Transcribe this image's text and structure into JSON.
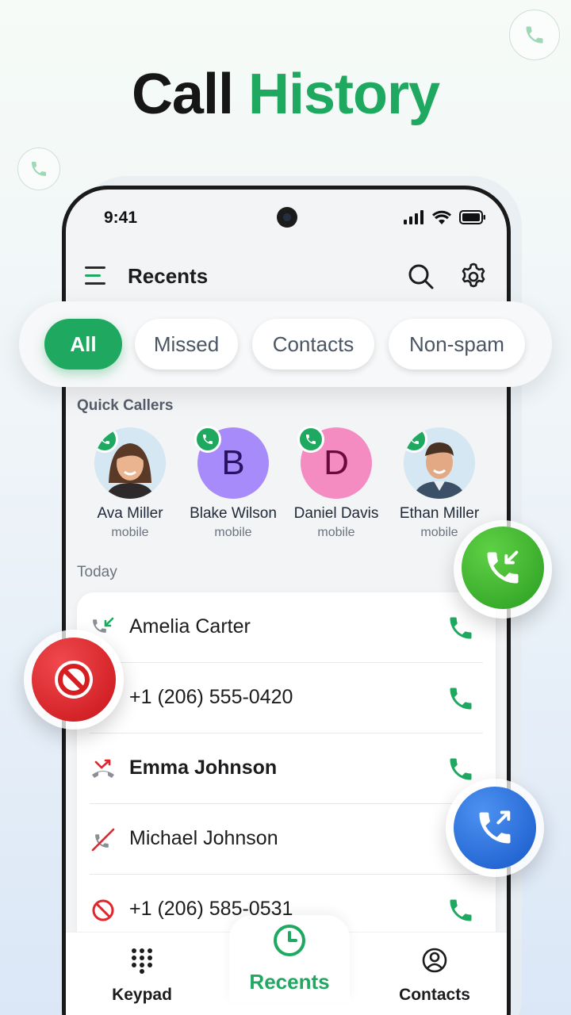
{
  "headline": {
    "part1": "Call",
    "part2": "History"
  },
  "status_bar": {
    "time": "9:41"
  },
  "appbar": {
    "title": "Recents"
  },
  "filters": [
    {
      "label": "All",
      "active": true
    },
    {
      "label": "Missed",
      "active": false
    },
    {
      "label": "Contacts",
      "active": false
    },
    {
      "label": "Non-spam",
      "active": false
    }
  ],
  "quick_callers": {
    "title": "Quick Callers",
    "items": [
      {
        "name": "Ava Miller",
        "type": "mobile",
        "initial": "",
        "avatar": "photo-woman"
      },
      {
        "name": "Blake Wilson",
        "type": "mobile",
        "initial": "B",
        "bg": "#a78bfa",
        "fg": "#2a1363"
      },
      {
        "name": "Daniel Davis",
        "type": "mobile",
        "initial": "D",
        "bg": "#f58cc1",
        "fg": "#6a0b3c"
      },
      {
        "name": "Ethan Miller",
        "type": "mobile",
        "initial": "",
        "avatar": "photo-man"
      }
    ]
  },
  "today": {
    "title": "Today",
    "calls": [
      {
        "name": "Amelia Carter",
        "kind": "incoming",
        "bold": false
      },
      {
        "name": "+1 (206) 555-0420",
        "kind": "blocked",
        "bold": false
      },
      {
        "name": "Emma Johnson",
        "kind": "missed",
        "bold": true
      },
      {
        "name": "Michael Johnson",
        "kind": "declined",
        "bold": false
      },
      {
        "name": "+1 (206) 585-0531",
        "kind": "blocked",
        "bold": false
      }
    ]
  },
  "bottom_nav": {
    "keypad": "Keypad",
    "recents": "Recents",
    "contacts": "Contacts"
  },
  "colors": {
    "accent": "#1fa860",
    "incoming_fab": "#34b233",
    "outgoing_fab": "#1f6fe0",
    "block_fab": "#e0262b"
  }
}
